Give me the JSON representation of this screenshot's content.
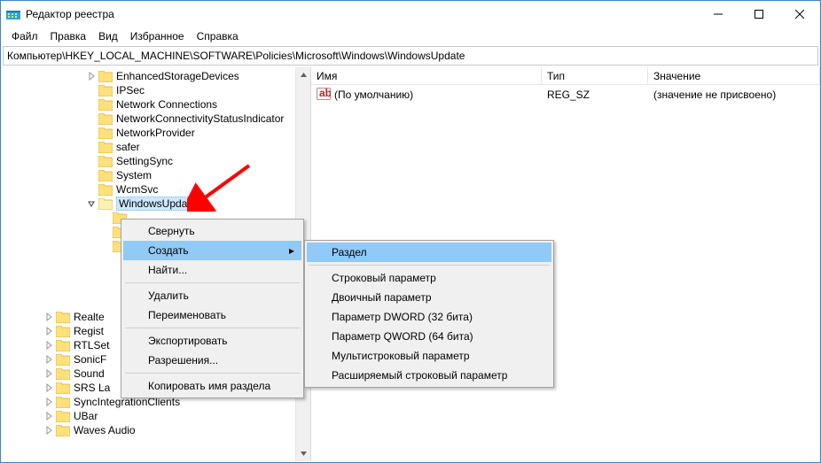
{
  "title": "Редактор реестра",
  "menu": {
    "file": "Файл",
    "edit": "Правка",
    "view": "Вид",
    "fav": "Избранное",
    "help": "Справка"
  },
  "address": "Компьютер\\HKEY_LOCAL_MACHINE\\SOFTWARE\\Policies\\Microsoft\\Windows\\WindowsUpdate",
  "tree_top": [
    "EnhancedStorageDevices",
    "IPSec",
    "Network Connections",
    "NetworkConnectivityStatusIndicator",
    "NetworkProvider",
    "safer",
    "SettingSync",
    "System",
    "WcmSvc",
    "WindowsUpdate"
  ],
  "tree_mid_hidden": [
    "???",
    "???",
    "???"
  ],
  "tree_bottom": [
    "Realte",
    "Regist",
    "RTLSet",
    "SonicF",
    "Sound",
    "SRS La",
    "SyncIntegrationClients",
    "UBar",
    "Waves Audio"
  ],
  "columns": {
    "name": "Имя",
    "type": "Тип",
    "value": "Значение"
  },
  "row": {
    "name": "(По умолчанию)",
    "type": "REG_SZ",
    "value": "(значение не присвоено)"
  },
  "ctx1": {
    "collapse": "Свернуть",
    "new": "Создать",
    "find": "Найти...",
    "delete": "Удалить",
    "rename": "Переименовать",
    "export": "Экспортировать",
    "perm": "Разрешения...",
    "copykey": "Копировать имя раздела"
  },
  "ctx2": {
    "key": "Раздел",
    "string": "Строковый параметр",
    "binary": "Двоичный параметр",
    "dword": "Параметр DWORD (32 бита)",
    "qword": "Параметр QWORD (64 бита)",
    "multi": "Мультистроковый параметр",
    "expand": "Расширяемый строковый параметр"
  }
}
